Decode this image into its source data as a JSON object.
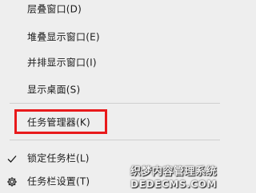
{
  "menu": {
    "items": [
      {
        "label": "层叠窗口(D)"
      },
      {
        "label": "堆叠显示窗口(E)"
      },
      {
        "label": "并排显示窗口(I)"
      },
      {
        "label": "显示桌面(S)"
      },
      {
        "label": "任务管理器(K)"
      },
      {
        "label": "锁定任务栏(L)",
        "icon": "checkmark-icon",
        "checked": true
      },
      {
        "label": "任务栏设置(T)",
        "icon": "gear-icon"
      }
    ]
  },
  "highlight_color": "#e8191b",
  "watermark": {
    "line1": "织梦内容管理系统",
    "line2": "DEDECMS.COM"
  }
}
